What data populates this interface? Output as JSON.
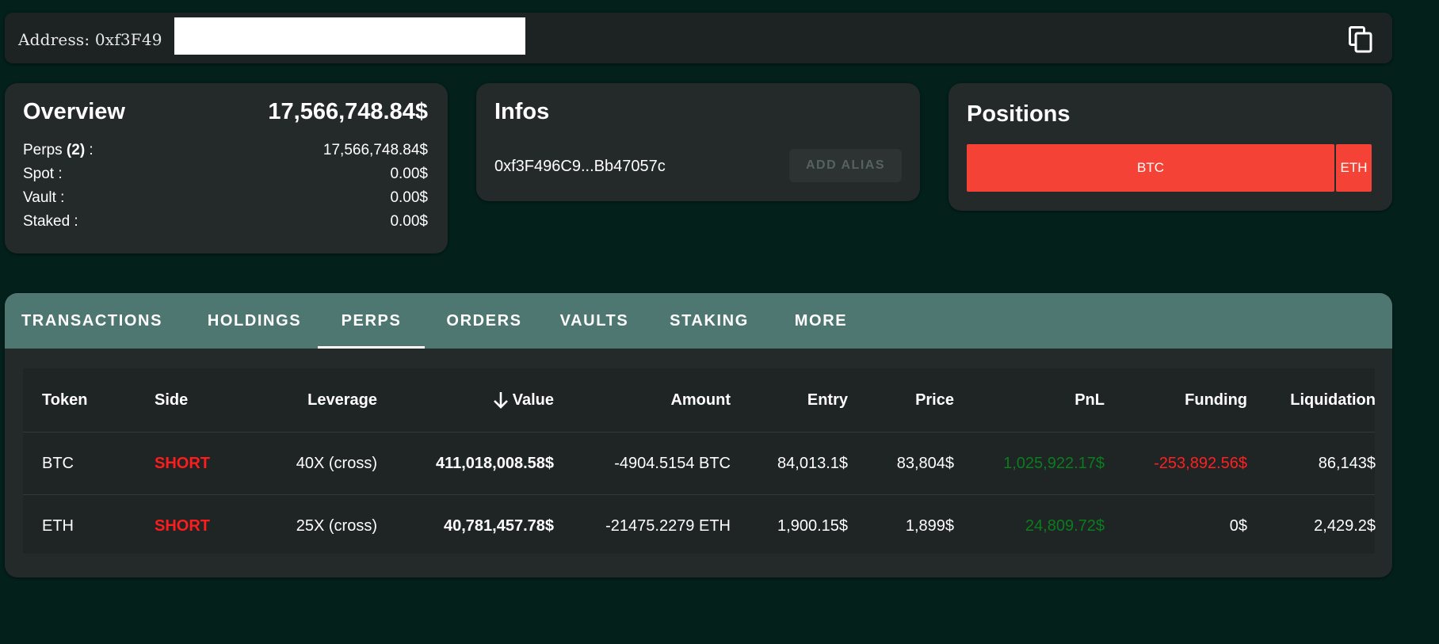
{
  "address_bar": {
    "label": "Address: 0xf3F49"
  },
  "overview": {
    "title": "Overview",
    "total": "17,566,748.84$",
    "rows": [
      {
        "label_prefix": "Perps ",
        "label_count": "(2)",
        "label_suffix": " :",
        "value": "17,566,748.84$"
      },
      {
        "label": "Spot :",
        "value": "0.00$"
      },
      {
        "label": "Vault :",
        "value": "0.00$"
      },
      {
        "label": "Staked :",
        "value": "0.00$"
      }
    ]
  },
  "infos": {
    "title": "Infos",
    "address": "0xf3F496C9...Bb47057c",
    "add_alias_label": "ADD ALIAS"
  },
  "positions": {
    "title": "Positions",
    "segments": [
      {
        "label": "BTC",
        "share": 0.91
      },
      {
        "label": "ETH",
        "share": 0.09
      }
    ],
    "color": "#f44336"
  },
  "tabs": {
    "items": [
      {
        "label": "TRANSACTIONS"
      },
      {
        "label": "HOLDINGS"
      },
      {
        "label": "PERPS"
      },
      {
        "label": "ORDERS"
      },
      {
        "label": "VAULTS"
      },
      {
        "label": "STAKING"
      },
      {
        "label": "MORE"
      }
    ],
    "active": "PERPS"
  },
  "table": {
    "headers": {
      "token": "Token",
      "side": "Side",
      "leverage": "Leverage",
      "value": "Value",
      "amount": "Amount",
      "entry": "Entry",
      "price": "Price",
      "pnl": "PnL",
      "funding": "Funding",
      "liquidation": "Liquidation"
    },
    "rows": [
      {
        "token": "BTC",
        "side": "SHORT",
        "leverage": "40X (cross)",
        "value": "411,018,008.58$",
        "amount": "-4904.5154 BTC",
        "entry": "84,013.1$",
        "price": "83,804$",
        "pnl": "1,025,922.17$",
        "funding": "-253,892.56$",
        "liquidation": "86,143$"
      },
      {
        "token": "ETH",
        "side": "SHORT",
        "leverage": "25X (cross)",
        "value": "40,781,457.78$",
        "amount": "-21475.2279 ETH",
        "entry": "1,900.15$",
        "price": "1,899$",
        "pnl": "24,809.72$",
        "funding": "0$",
        "liquidation": "2,429.2$"
      }
    ]
  },
  "colors": {
    "background": "#03201b",
    "card": "#242a2a",
    "tab_bar": "#4f7771",
    "short": "#ff1c1c",
    "profit": "#0b7d1e",
    "loss": "#ff2020"
  }
}
